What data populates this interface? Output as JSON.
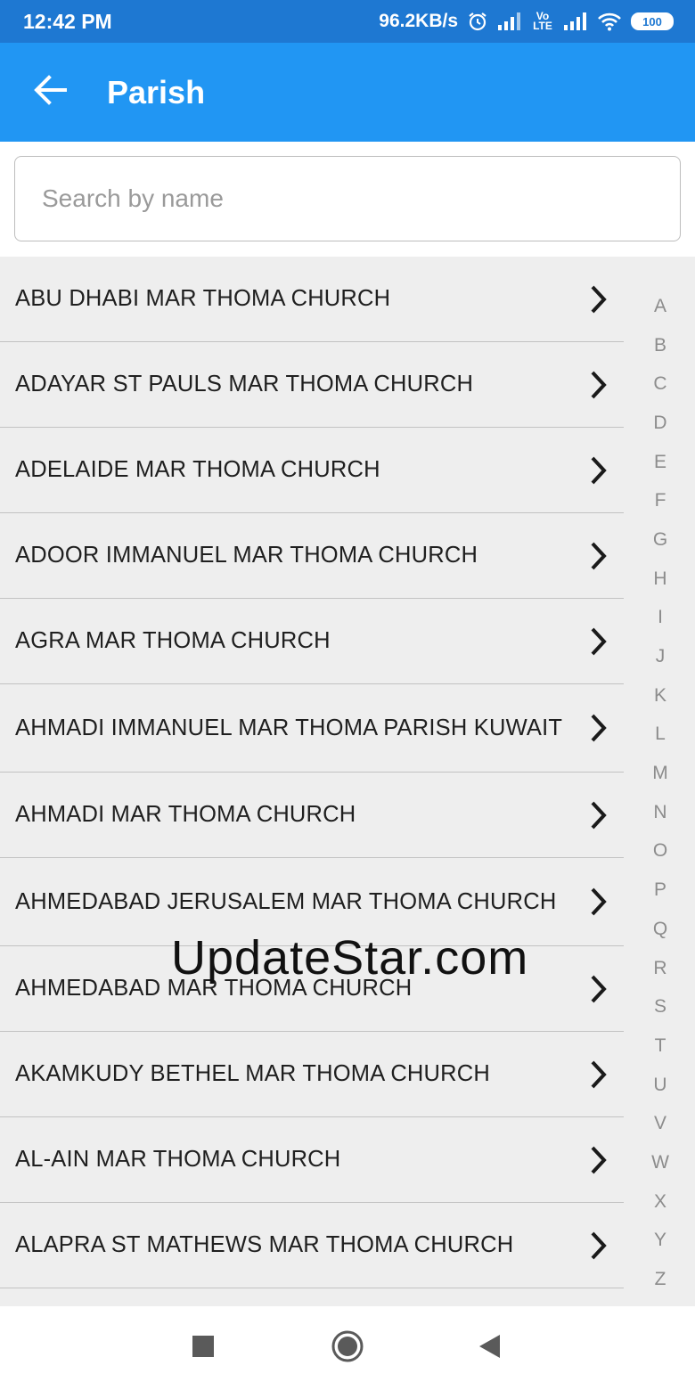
{
  "status_bar": {
    "time": "12:42 PM",
    "net_speed": "96.2KB/s",
    "volte": "Vo LTE",
    "battery": "100"
  },
  "app_bar": {
    "title": "Parish"
  },
  "search": {
    "placeholder": "Search by name",
    "value": ""
  },
  "parishes": [
    "ABU DHABI MAR THOMA CHURCH",
    "ADAYAR ST PAULS MAR THOMA CHURCH",
    "ADELAIDE MAR THOMA CHURCH",
    "ADOOR IMMANUEL MAR THOMA CHURCH",
    "AGRA MAR THOMA CHURCH",
    "AHMADI IMMANUEL MAR THOMA PARISH KUWAIT",
    "AHMADI MAR THOMA CHURCH",
    "AHMEDABAD JERUSALEM MAR THOMA CHURCH",
    "AHMEDABAD MAR THOMA CHURCH",
    "AKAMKUDY BETHEL MAR THOMA CHURCH",
    "AL-AIN MAR THOMA CHURCH",
    "ALAPRA ST MATHEWS MAR THOMA CHURCH"
  ],
  "alphabet": [
    "A",
    "B",
    "C",
    "D",
    "E",
    "F",
    "G",
    "H",
    "I",
    "J",
    "K",
    "L",
    "M",
    "N",
    "O",
    "P",
    "Q",
    "R",
    "S",
    "T",
    "U",
    "V",
    "W",
    "X",
    "Y",
    "Z"
  ],
  "watermark": "UpdateStar.com",
  "colors": {
    "status_bar": "#1E78D2",
    "app_bar": "#2196F3",
    "list_bg": "#EEEEEE"
  },
  "icons": {
    "back": "arrow-left-icon",
    "row": "chevron-right-icon",
    "nav_recents": "square-icon",
    "nav_home": "circle-icon",
    "nav_back": "triangle-icon"
  }
}
